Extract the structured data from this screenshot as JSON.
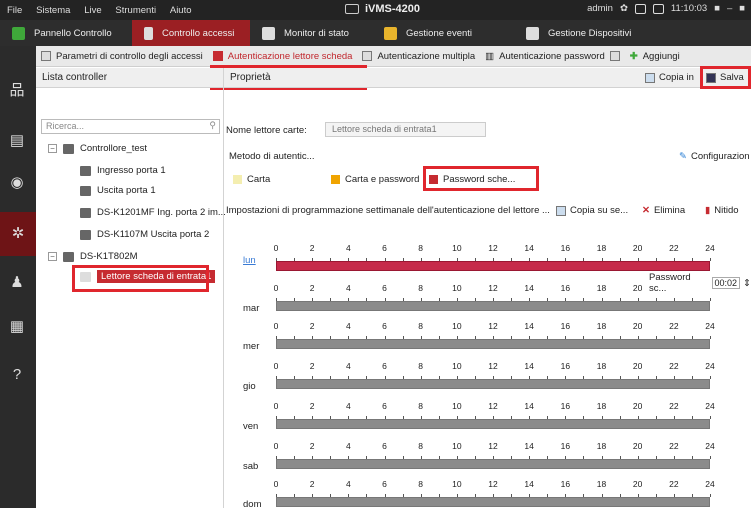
{
  "menubar": {
    "items": [
      "File",
      "Sistema",
      "Live",
      "Strumenti",
      "Aiuto"
    ],
    "app_title": "iVMS-4200",
    "user": "admin",
    "time": "11:10:03"
  },
  "main_tabs": [
    {
      "label": "Pannello Controllo",
      "icon": "grid-icon",
      "color": "#3fa83a"
    },
    {
      "label": "Controllo accessi",
      "icon": "door-icon",
      "color": "#dddddd"
    },
    {
      "label": "Monitor di stato",
      "icon": "monitor-icon",
      "color": "#dddddd"
    },
    {
      "label": "Gestione eventi",
      "icon": "folder-icon",
      "color": "#e8b42c"
    },
    {
      "label": "Gestione Dispositivi",
      "icon": "device-icon",
      "color": "#dddddd"
    }
  ],
  "sub_tabs": {
    "params": "Parametri di controllo degli accessi",
    "card_auth": "Autenticazione lettore scheda",
    "multi_auth": "Autenticazione multipla",
    "password_auth": "Autenticazione password",
    "add": "Aggiungi"
  },
  "controller_list": {
    "title": "Lista controller",
    "search_placeholder": "Ricerca...",
    "tree": [
      "Controllore_test",
      "Ingresso porta 1",
      "Uscita porta 1",
      "DS-K1201MF Ing. porta 2 im...",
      "DS-K1107M Uscita porta 2",
      "DS-K1T802M",
      "Lettore scheda di entrata1"
    ]
  },
  "properties": {
    "title": "Proprietà",
    "copy_in": "Copia in",
    "save": "Salva",
    "reader_name_label": "Nome lettore carte:",
    "reader_name_value": "Lettore scheda di entrata1",
    "auth_method_label": "Metodo di autentic...",
    "config": "Configurazion",
    "legend": [
      {
        "label": "Carta",
        "color": "#f4eeb0"
      },
      {
        "label": "Carta e password",
        "color": "#f0a400"
      },
      {
        "label": "Password sche...",
        "color": "#c62b31"
      }
    ],
    "schedule_title": "Impostazioni di programmazione settimanale dell'autenticazione del lettore ...",
    "copy_to": "Copia su se...",
    "delete": "Elimina",
    "clear": "Nitido"
  },
  "schedule": {
    "hours": [
      "0",
      "2",
      "4",
      "6",
      "8",
      "10",
      "12",
      "14",
      "16",
      "18",
      "20",
      "22",
      "24"
    ],
    "days": [
      {
        "name": "lun",
        "active": true
      },
      {
        "name": "mar",
        "active": false
      },
      {
        "name": "mer",
        "active": false
      },
      {
        "name": "gio",
        "active": false
      },
      {
        "name": "ven",
        "active": false
      },
      {
        "name": "sab",
        "active": false
      },
      {
        "name": "dom",
        "active": false
      }
    ],
    "tooltip_label": "Password sc...",
    "tooltip_value": "00:02"
  },
  "colors": {
    "accent": "#c62b31",
    "highlight": "#e0262d"
  }
}
